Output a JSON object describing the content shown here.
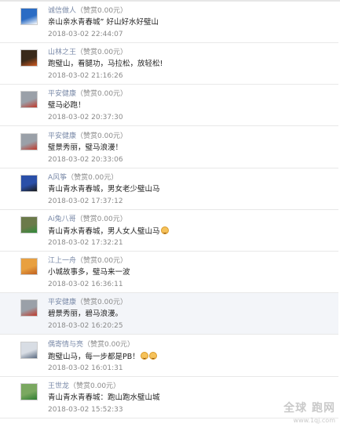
{
  "comments": [
    {
      "user": "诚信做人",
      "reward": "（赞赏0.00元）",
      "text": "亲山亲水青春城” 好山好水好璧山",
      "time": "2018-03-02 22:44:07",
      "avatar_colors": [
        "#2b6cc4",
        "#ffffff"
      ],
      "emoji_count": 0,
      "highlight": false
    },
    {
      "user": "山林之王",
      "reward": "（赞赏0.00元）",
      "text": "跑璧山，看腿功，马拉松，放轻松!",
      "time": "2018-03-02 21:16:26",
      "avatar_colors": [
        "#3a2a1a",
        "#d05a20"
      ],
      "emoji_count": 0,
      "highlight": false
    },
    {
      "user": "平安健康",
      "reward": "（赞赏0.00元）",
      "text": "璧马必跑！",
      "time": "2018-03-02 20:37:30",
      "avatar_colors": [
        "#9aa0a8",
        "#c0392b"
      ],
      "emoji_count": 0,
      "highlight": false
    },
    {
      "user": "平安健康",
      "reward": "（赞赏0.00元）",
      "text": "璧景秀丽，璧马浪漫！",
      "time": "2018-03-02 20:33:06",
      "avatar_colors": [
        "#9aa0a8",
        "#c0392b"
      ],
      "emoji_count": 0,
      "highlight": false
    },
    {
      "user": "A风筝",
      "reward": "（赞赏0.00元）",
      "text": "青山青水青春城，男女老少璧山马",
      "time": "2018-03-02 17:37:12",
      "avatar_colors": [
        "#2a4fa8",
        "#1a1a1a"
      ],
      "emoji_count": 0,
      "highlight": false
    },
    {
      "user": "Ai兔八哥",
      "reward": "（赞赏0.00元）",
      "text": "青山青水青春城，男人女人璧山马",
      "time": "2018-03-02 17:32:21",
      "avatar_colors": [
        "#6b7a4a",
        "#2e8b3a"
      ],
      "emoji_count": 1,
      "highlight": false
    },
    {
      "user": "江上一舟",
      "reward": "（赞赏0.00元）",
      "text": "小城故事多，璧马来一波",
      "time": "2018-03-02 16:36:11",
      "avatar_colors": [
        "#e8a040",
        "#c06020"
      ],
      "emoji_count": 0,
      "highlight": false
    },
    {
      "user": "平安健康",
      "reward": "（赞赏0.00元）",
      "text": "碧景秀丽，碧马浪漫。",
      "time": "2018-03-02 16:20:25",
      "avatar_colors": [
        "#9aa0a8",
        "#c0392b"
      ],
      "emoji_count": 0,
      "highlight": true
    },
    {
      "user": "偶寄情与亮",
      "reward": "（赞赏0.00元）",
      "text": "跑璧山马，每一步都是PB！",
      "time": "2018-03-02 16:01:31",
      "avatar_colors": [
        "#d8dde4",
        "#5a6a80"
      ],
      "emoji_count": 2,
      "highlight": false
    },
    {
      "user": "王世龙",
      "reward": "（赞赏0.00元）",
      "text": "青山青水青春城：跑山跑水璧山城",
      "time": "2018-03-02 15:52:33",
      "avatar_colors": [
        "#7aa860",
        "#2e7d32"
      ],
      "emoji_count": 0,
      "highlight": false
    }
  ],
  "watermark": {
    "line1": "全球 跑网",
    "line2": "www.1qj.com"
  }
}
